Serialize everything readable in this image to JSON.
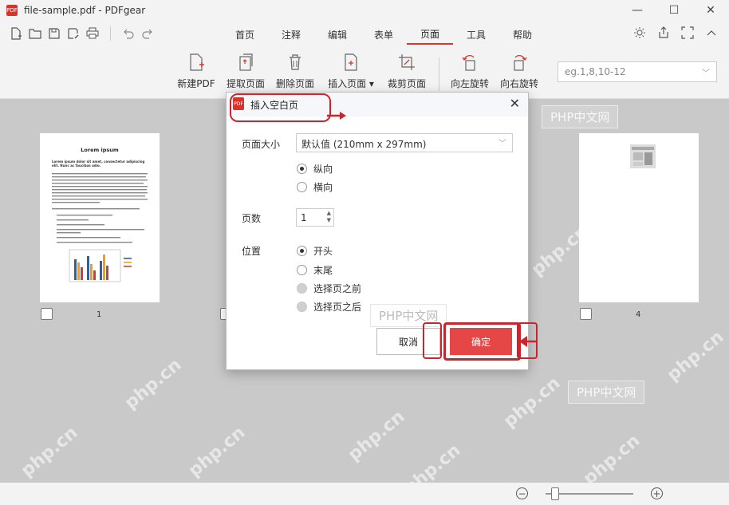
{
  "window": {
    "title": "file-sample.pdf - PDFgear",
    "logo_text": "PDF",
    "controls": [
      "—",
      "☐",
      "✕"
    ]
  },
  "menu": {
    "tabs": [
      "首页",
      "注释",
      "编辑",
      "表单",
      "页面",
      "工具",
      "帮助"
    ],
    "active_tab": "页面"
  },
  "tools": {
    "new_pdf": "新建PDF",
    "extract": "提取页面",
    "delete": "删除页面",
    "insert": "插入页面 ▾",
    "crop": "裁剪页面",
    "rotate_left": "向左旋转",
    "rotate_right": "向右旋转"
  },
  "page_range": {
    "placeholder": "eg.1,8,10-12"
  },
  "thumbnails": {
    "page1": {
      "num": "1",
      "heading": "Lorem ipsum",
      "subheading": "Lorem ipsum dolor sit amet, consectetur adipiscing elit. Nunc ac faucibus odio."
    },
    "page4": {
      "num": "4"
    }
  },
  "dialog": {
    "title": "插入空白页",
    "page_size_label": "页面大小",
    "page_size_value": "默认值 (210mm x 297mm)",
    "orientation": {
      "portrait": "纵向",
      "landscape": "横向",
      "selected": "纵向"
    },
    "count_label": "页数",
    "count_value": "1",
    "position_label": "位置",
    "position": {
      "start": "开头",
      "end": "末尾",
      "before_selected": "选择页之前",
      "after_selected": "选择页之后",
      "selected": "开头"
    },
    "cancel": "取消",
    "ok": "确定"
  },
  "watermarks": {
    "box": "PHP中文网",
    "diag": "php.cn"
  },
  "colors": {
    "accent": "#d9342b",
    "ok_button": "#e54646",
    "annotation": "#c8262e",
    "workspace": "#c9c9c9"
  },
  "icons": {
    "quick_access": [
      "new-file-icon",
      "open-folder-icon",
      "save-icon",
      "save-as-icon",
      "print-icon",
      "undo-icon",
      "redo-icon"
    ],
    "right": [
      "brightness-icon",
      "share-icon",
      "fullscreen-icon",
      "collapse-icon"
    ]
  }
}
